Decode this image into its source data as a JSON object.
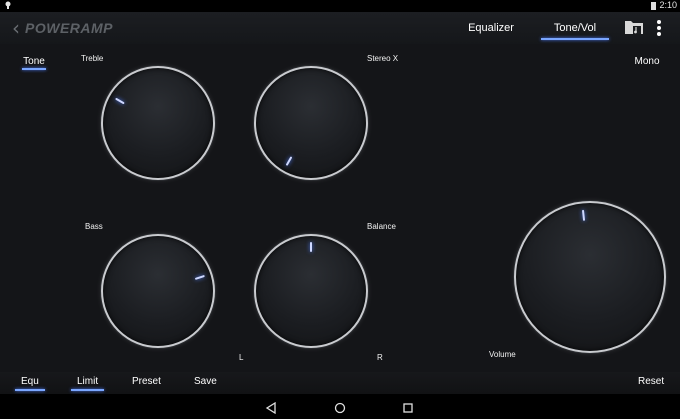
{
  "status_bar": {
    "time": "2:10"
  },
  "action_bar": {
    "logo": "POWERAMP",
    "tabs": [
      {
        "label": "Equalizer",
        "active": false
      },
      {
        "label": "Tone/Vol",
        "active": true
      }
    ],
    "icons": [
      "folder-music-icon",
      "overflow-menu-icon"
    ]
  },
  "main": {
    "tone_tab": "Tone",
    "mono_button": "Mono",
    "knobs": {
      "treble": {
        "label": "Treble"
      },
      "stereo_x": {
        "label": "Stereo X"
      },
      "bass": {
        "label": "Bass"
      },
      "balance": {
        "label": "Balance",
        "left": "L",
        "right": "R"
      },
      "volume": {
        "label": "Volume"
      }
    }
  },
  "bottom_bar": {
    "equ": "Equ",
    "limit": "Limit",
    "preset": "Preset",
    "save": "Save",
    "reset": "Reset"
  },
  "nav_bar": [
    "back-icon",
    "home-icon",
    "recents-icon"
  ],
  "colors": {
    "accent": "#7aa6ff",
    "background": "#141518"
  }
}
